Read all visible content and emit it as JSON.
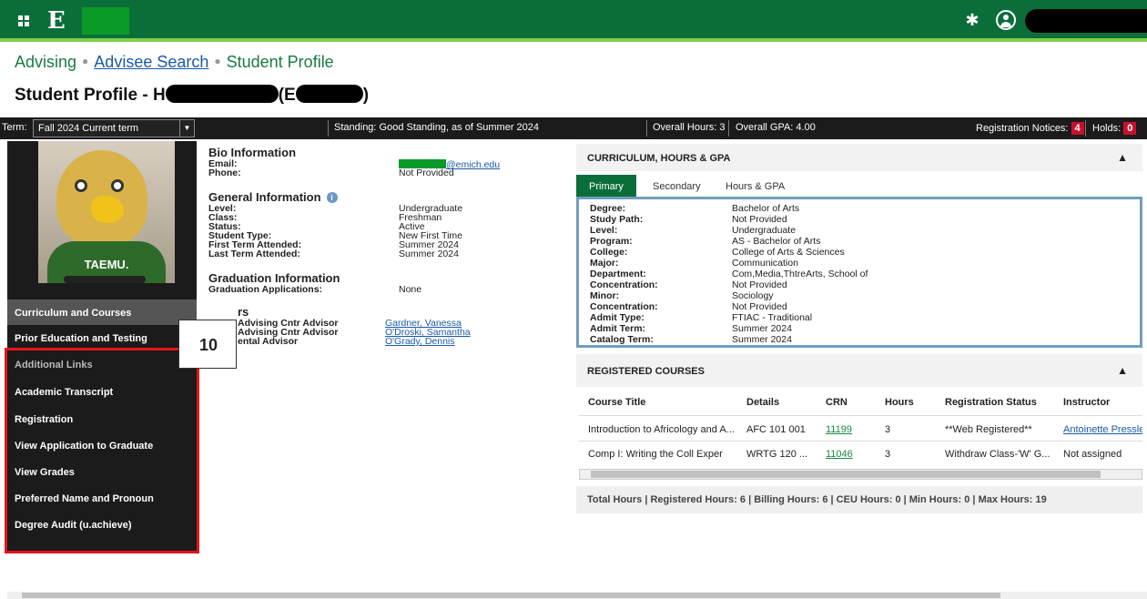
{
  "app": {
    "logo_letter": "E"
  },
  "breadcrumb": {
    "advising": "Advising",
    "search": "Advisee Search",
    "profile": "Student Profile"
  },
  "page": {
    "title_prefix": "Student Profile - H",
    "title_mid": "(E",
    "title_end": ")"
  },
  "infobar": {
    "term_label": "Term:",
    "term_value": "Fall 2024 Current term",
    "standing": "Standing: Good Standing, as of Summer 2024",
    "overall_hours": "Overall Hours: 3",
    "overall_gpa": "Overall GPA: 4.00",
    "reg_notices_label": "Registration Notices:",
    "reg_notices_count": "4",
    "holds_label": "Holds:",
    "holds_count": "0"
  },
  "sidebar": {
    "shirt_text": "TAEMU.",
    "items": [
      "Curriculum and Courses",
      "Prior Education and Testing",
      "Additional Links",
      "Academic Transcript",
      "Registration",
      "View Application to Graduate",
      "View Grades",
      "Preferred Name and Pronoun",
      "Degree Audit (u.achieve)"
    ]
  },
  "callout": "10",
  "bio": {
    "heading": "Bio Information",
    "email_label": "Email:",
    "email_value": "@emich.edu",
    "phone_label": "Phone:",
    "phone_value": "Not Provided"
  },
  "general": {
    "heading": "General Information",
    "rows": [
      [
        "Level:",
        "Undergraduate"
      ],
      [
        "Class:",
        "Freshman"
      ],
      [
        "Status:",
        "Active"
      ],
      [
        "Student Type:",
        "New First Time"
      ],
      [
        "First Term Attended:",
        "Summer 2024"
      ],
      [
        "Last Term Attended:",
        "Summer 2024"
      ]
    ]
  },
  "graduation": {
    "heading": "Graduation Information",
    "label": "Graduation Applications:",
    "value": "None"
  },
  "advisors": {
    "heading_fragment": "rs",
    "rows": [
      [
        "Advising Cntr Advisor",
        "Gardner, Vanessa"
      ],
      [
        "Advising Cntr Advisor",
        "O'Droski, Samantha"
      ],
      [
        "ental Advisor",
        "O'Grady, Dennis"
      ]
    ]
  },
  "curriculum": {
    "title": "CURRICULUM, HOURS & GPA",
    "tabs": [
      "Primary",
      "Secondary",
      "Hours & GPA"
    ],
    "rows": [
      [
        "Degree:",
        "Bachelor of Arts"
      ],
      [
        "Study Path:",
        "Not Provided"
      ],
      [
        "Level:",
        "Undergraduate"
      ],
      [
        "Program:",
        "AS - Bachelor of Arts"
      ],
      [
        "College:",
        "College of Arts & Sciences"
      ],
      [
        "Major:",
        "Communication"
      ],
      [
        "Department:",
        "Com,Media,ThtreArts, School of"
      ],
      [
        "Concentration:",
        "Not Provided"
      ],
      [
        "Minor:",
        "Sociology"
      ],
      [
        "Concentration:",
        "Not Provided"
      ],
      [
        "Admit Type:",
        "FTIAC - Traditional"
      ],
      [
        "Admit Term:",
        "Summer 2024"
      ],
      [
        "Catalog Term:",
        "Summer 2024"
      ]
    ]
  },
  "courses": {
    "title": "REGISTERED COURSES",
    "columns": [
      "Course Title",
      "Details",
      "CRN",
      "Hours",
      "Registration Status",
      "Instructor"
    ],
    "rows": [
      [
        "Introduction to Africology and A...",
        "AFC 101 001",
        "11199",
        "3",
        "**Web Registered**",
        "Antoinette Pressle"
      ],
      [
        "Comp I: Writing the Coll Exper",
        "WRTG 120 ...",
        "11046",
        "3",
        "Withdraw Class-'W' G...",
        "Not assigned"
      ]
    ],
    "totals": "Total Hours |  Registered Hours:  6  |  Billing Hours:  6  |  CEU Hours:  0  |  Min Hours:  0  |  Max Hours:  19"
  }
}
